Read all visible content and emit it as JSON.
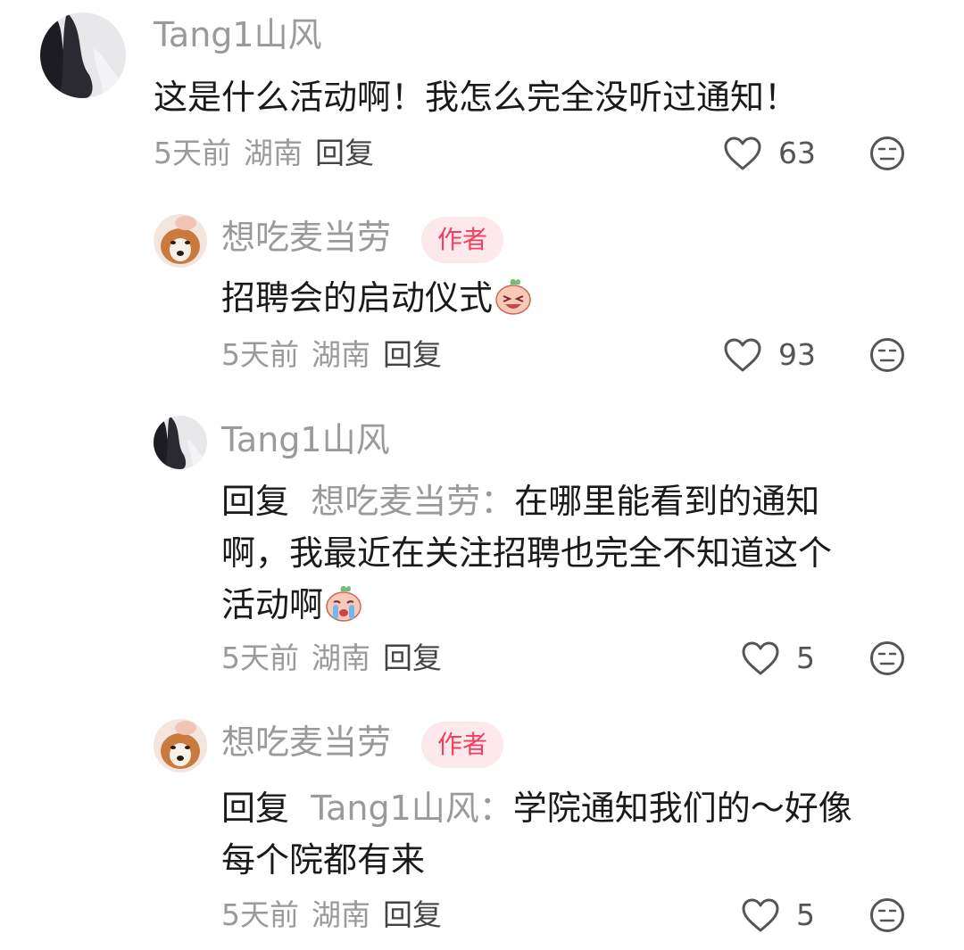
{
  "comments": [
    {
      "username": "Tang1山风",
      "text": "这是什么活动啊！我怎么完全没听过通知！",
      "time": "5天前",
      "location": "湖南",
      "reply_label": "回复",
      "likes": "63"
    },
    {
      "username": "想吃麦当劳",
      "badge": "作者",
      "text": "招聘会的启动仪式",
      "emoji": "laughing-emoji",
      "time": "5天前",
      "location": "湖南",
      "reply_label": "回复",
      "likes": "93"
    },
    {
      "username": "Tang1山风",
      "reply_prefix": "回复",
      "reply_to": "想吃麦当劳：",
      "text_lines": [
        "在哪里能看到的通知",
        "啊，我最近在关注招聘也完全不知道这个",
        "活动啊"
      ],
      "emoji": "crying-emoji",
      "time": "5天前",
      "location": "湖南",
      "reply_label": "回复",
      "likes": "5"
    },
    {
      "username": "想吃麦当劳",
      "badge": "作者",
      "reply_prefix": "回复",
      "reply_to": "Tang1山风：",
      "text_lines": [
        "学院通知我们的～好像",
        "每个院都有来"
      ],
      "time": "5天前",
      "location": "湖南",
      "reply_label": "回复",
      "likes": "5"
    }
  ],
  "icons": {
    "like": "heart-outline-icon",
    "dislike": "meh-face-icon"
  },
  "colors": {
    "username": "#9a9a9a",
    "badge_bg": "#fde9ec",
    "badge_text": "#f0405e",
    "text": "#1a1a1a"
  }
}
